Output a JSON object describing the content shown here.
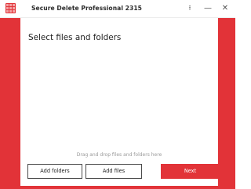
{
  "window": {
    "title": "Secure Delete Professional 2315",
    "menu_glyph": "⋮",
    "minimize_glyph": "—",
    "close_glyph": "✕",
    "accent_color": "#e23338"
  },
  "main": {
    "heading": "Select files and folders",
    "drop_hint": "Drag and drop files and folders here"
  },
  "actions": {
    "add_folders_label": "Add folders",
    "add_files_label": "Add files",
    "next_label": "Next"
  },
  "icons": {
    "app": "app-logo-icon",
    "menu": "more-vertical-icon",
    "minimize": "minimize-icon",
    "close": "close-icon"
  }
}
